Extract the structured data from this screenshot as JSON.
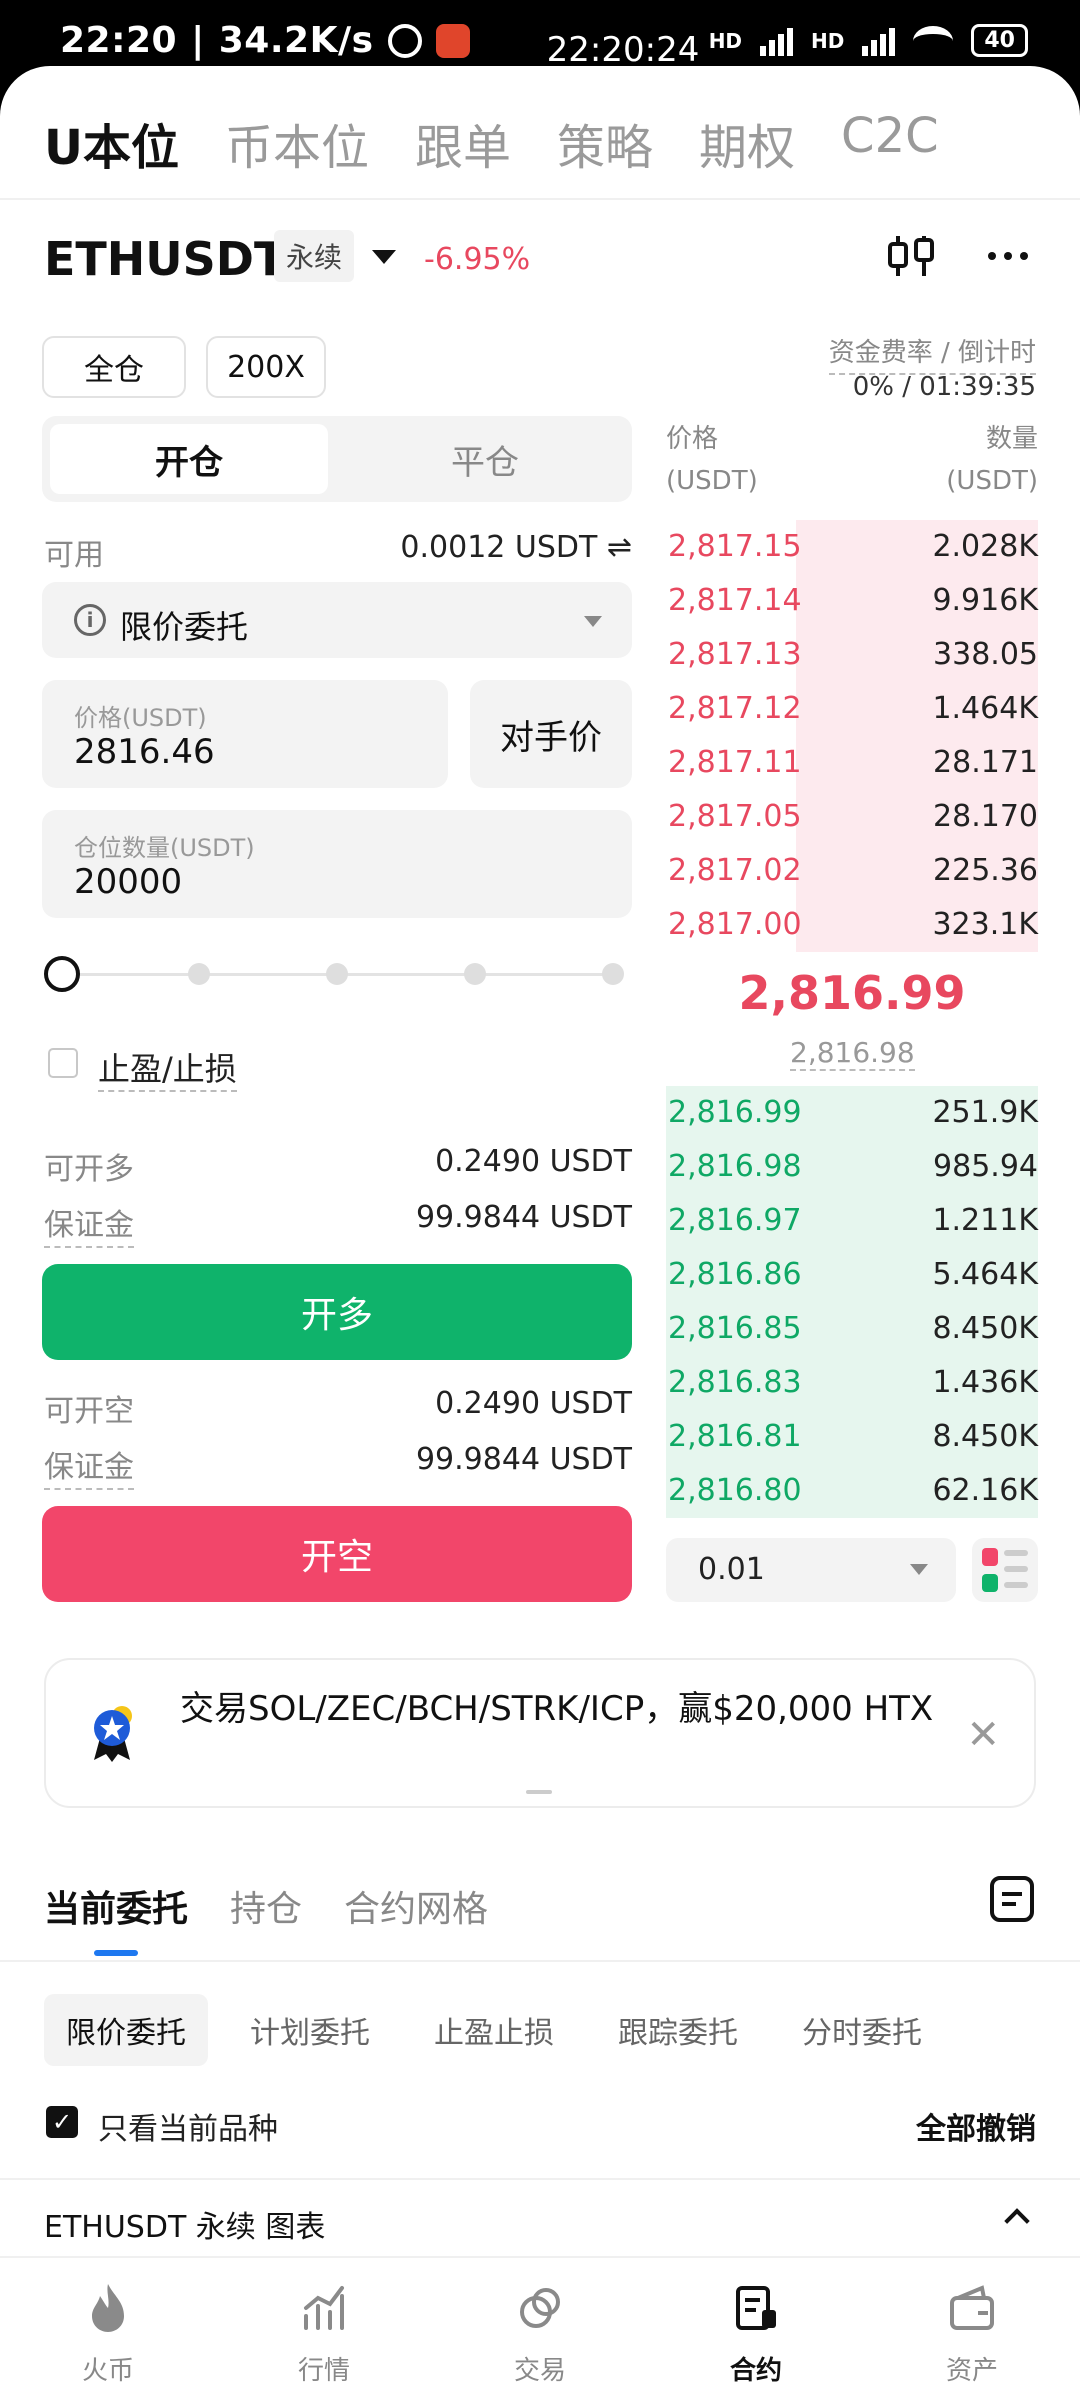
{
  "status_bar": {
    "time": "22:20",
    "speed": "34.2K/s",
    "center_time": "22:20:24",
    "net1": "HD",
    "net2": "HD",
    "battery": "40"
  },
  "top_nav": {
    "tabs": [
      "U本位",
      "币本位",
      "跟单",
      "策略",
      "期权",
      "C2C"
    ],
    "active_index": 0
  },
  "market": {
    "symbol": "ETHUSDT",
    "type_tag": "永续",
    "change": "-6.95%"
  },
  "settings": {
    "margin_mode": "全仓",
    "leverage": "200X",
    "funding_label": "资金费率 / 倒计时",
    "funding_value": "0% / 01:39:35"
  },
  "mode_tabs": {
    "open": "开仓",
    "close": "平仓"
  },
  "form": {
    "available_label": "可用",
    "available_value": "0.0012 USDT ⇌",
    "order_type": "限价委托",
    "price_placeholder": "价格(USDT)",
    "price_value": "2816.46",
    "counterparty_price": "对手价",
    "qty_placeholder": "仓位数量(USDT)",
    "qty_value": "20000",
    "slider_percent": 0,
    "tpsl_label": "止盈/止损",
    "can_long_label": "可开多",
    "can_long_value": "0.2490 USDT",
    "margin_label": "保证金",
    "long_margin_value": "99.9844 USDT",
    "long_button": "开多",
    "can_short_label": "可开空",
    "can_short_value": "0.2490 USDT",
    "short_margin_value": "99.9844 USDT",
    "short_button": "开空"
  },
  "order_book": {
    "price_header": "价格",
    "qty_header": "数量",
    "price_unit": "(USDT)",
    "qty_unit": "(USDT)",
    "asks": [
      {
        "price": "2,817.15",
        "qty": "2.028K",
        "depth": 0.65
      },
      {
        "price": "2,817.14",
        "qty": "9.916K",
        "depth": 0.65
      },
      {
        "price": "2,817.13",
        "qty": "338.05",
        "depth": 0.65
      },
      {
        "price": "2,817.12",
        "qty": "1.464K",
        "depth": 0.65
      },
      {
        "price": "2,817.11",
        "qty": "28.171",
        "depth": 0.65
      },
      {
        "price": "2,817.05",
        "qty": "28.170",
        "depth": 0.65
      },
      {
        "price": "2,817.02",
        "qty": "225.36",
        "depth": 0.65
      },
      {
        "price": "2,817.00",
        "qty": "323.1K",
        "depth": 0.65
      }
    ],
    "last_price": "2,816.99",
    "mark_price": "2,816.98",
    "bids": [
      {
        "price": "2,816.99",
        "qty": "251.9K",
        "depth": 1.0
      },
      {
        "price": "2,816.98",
        "qty": "985.94",
        "depth": 1.0
      },
      {
        "price": "2,816.97",
        "qty": "1.211K",
        "depth": 1.0
      },
      {
        "price": "2,816.86",
        "qty": "5.464K",
        "depth": 1.0
      },
      {
        "price": "2,816.85",
        "qty": "8.450K",
        "depth": 1.0
      },
      {
        "price": "2,816.83",
        "qty": "1.436K",
        "depth": 1.0
      },
      {
        "price": "2,816.81",
        "qty": "8.450K",
        "depth": 1.0
      },
      {
        "price": "2,816.80",
        "qty": "62.16K",
        "depth": 1.0
      }
    ],
    "depth_step": "0.01"
  },
  "banner": {
    "text": "交易SOL/ZEC/BCH/STRK/ICP，赢$20,000 HTX"
  },
  "orders": {
    "tabs": [
      "当前委托",
      "持仓",
      "合约网格"
    ],
    "active_index": 0,
    "chips": [
      "限价委托",
      "计划委托",
      "止盈止损",
      "跟踪委托",
      "分时委托"
    ],
    "active_chip": 0,
    "only_current_label": "只看当前品种",
    "cancel_all": "全部撤销",
    "chart_row": "ETHUSDT 永续 图表"
  },
  "bottom_nav": {
    "items": [
      "火币",
      "行情",
      "交易",
      "合约",
      "资产"
    ],
    "active_index": 3
  },
  "colors": {
    "green": "#0fb36b",
    "red": "#f2466a",
    "accent_blue": "#1e78f0"
  }
}
